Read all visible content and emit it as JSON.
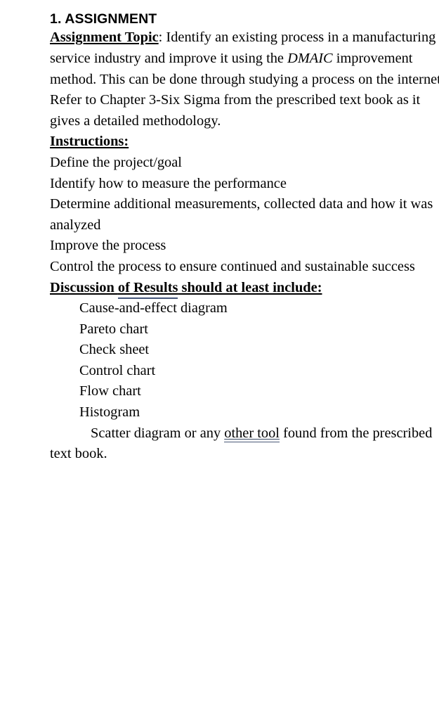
{
  "document": {
    "heading": "1. ASSIGNMENT",
    "topic": {
      "label": "Assignment Topic",
      "after_label": ": Identify an existing process in a manufacturing or service industry and improve it using the ",
      "emphasis": "DMAIC",
      "rest": " improvement method. This can be done through studying a process on the internet.  Refer to Chapter 3-Six Sigma from the prescribed text book as it gives a detailed methodology."
    },
    "instructions": {
      "heading": "Instructions:",
      "steps": [
        "Define the project/goal",
        " Identify how to measure the performance",
        " Determine additional measurements, collected data and how it was analyzed",
        "Improve the process",
        "Control the process to ensure continued and sustainable success"
      ]
    },
    "discussion": {
      "heading_part1": "Discussion ",
      "heading_marked": "of  Results",
      "heading_part2": " should at least include:",
      "tools": [
        "Cause-and-effect diagram",
        "Pareto chart",
        "Check sheet",
        "Control chart",
        "Flow chart",
        "Histogram"
      ],
      "closing": {
        "before": "Scatter diagram or any ",
        "marked": "other  tool",
        "after": " found from the prescribed text book."
      }
    }
  },
  "colors": {
    "text": "#000000",
    "page_background": "#ffffff",
    "grammar_underline": "#4a5a78"
  }
}
